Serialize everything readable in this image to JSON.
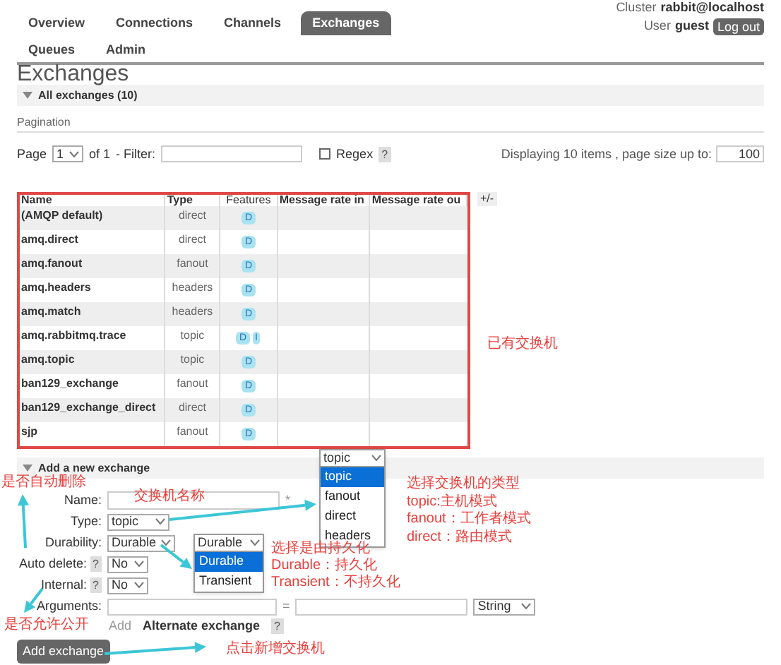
{
  "header": {
    "cluster_label": "Cluster",
    "cluster": "rabbit@localhost",
    "user_label": "User",
    "user": "guest",
    "logout": "Log out"
  },
  "tabs": [
    {
      "label": "Overview",
      "selected": false
    },
    {
      "label": "Connections",
      "selected": false
    },
    {
      "label": "Channels",
      "selected": false
    },
    {
      "label": "Exchanges",
      "selected": true
    },
    {
      "label": "Queues",
      "selected": false
    },
    {
      "label": "Admin",
      "selected": false
    }
  ],
  "page_title": "Exchanges",
  "all_section": {
    "title": "All exchanges (10)",
    "expanded": true
  },
  "pagination": {
    "label": "Pagination",
    "page_label": "Page",
    "page": "1",
    "of": "of 1",
    "filter_label": "- Filter:",
    "regex_label": "Regex",
    "regex_checked": false,
    "help": "?",
    "displaying": "Displaying 10 items , page size up to:",
    "page_size": "100"
  },
  "table": {
    "columns": [
      "Name",
      "Type",
      "Features",
      "Message rate in",
      "Message rate ou"
    ],
    "toggle": "+/-",
    "rows": [
      {
        "name": "(AMQP default)",
        "type": "direct",
        "features": [
          "D"
        ]
      },
      {
        "name": "amq.direct",
        "type": "direct",
        "features": [
          "D"
        ]
      },
      {
        "name": "amq.fanout",
        "type": "fanout",
        "features": [
          "D"
        ]
      },
      {
        "name": "amq.headers",
        "type": "headers",
        "features": [
          "D"
        ]
      },
      {
        "name": "amq.match",
        "type": "headers",
        "features": [
          "D"
        ]
      },
      {
        "name": "amq.rabbitmq.trace",
        "type": "topic",
        "features": [
          "D",
          "I"
        ]
      },
      {
        "name": "amq.topic",
        "type": "topic",
        "features": [
          "D"
        ]
      },
      {
        "name": "ban129_exchange",
        "type": "fanout",
        "features": [
          "D"
        ]
      },
      {
        "name": "ban129_exchange_direct",
        "type": "direct",
        "features": [
          "D"
        ]
      },
      {
        "name": "sjp",
        "type": "fanout",
        "features": [
          "D"
        ]
      }
    ]
  },
  "add_section": {
    "title": "Add a new exchange",
    "expanded": true,
    "fields": [
      {
        "kind": "text",
        "label": "Name:",
        "required": "*"
      },
      {
        "kind": "select",
        "label": "Type:",
        "value": "topic"
      },
      {
        "kind": "select",
        "label": "Durability:",
        "value": "Durable"
      },
      {
        "kind": "select_help",
        "label": "Auto delete:",
        "help": "?",
        "value": "No"
      },
      {
        "kind": "select_help",
        "label": "Internal:",
        "help": "?",
        "value": "No"
      },
      {
        "kind": "arguments",
        "label": "Arguments:",
        "separator": "=",
        "value_type": "String"
      },
      {
        "kind": "links",
        "add": "Add",
        "alternate": "Alternate exchange",
        "help": "?"
      }
    ],
    "button": "Add exchange"
  },
  "type_dropdown": {
    "value": "topic",
    "options": [
      {
        "label": "topic",
        "selected": true
      },
      {
        "label": "fanout",
        "selected": false
      },
      {
        "label": "direct",
        "selected": false
      },
      {
        "label": "headers",
        "selected": false
      }
    ]
  },
  "durability_dropdown": {
    "value": "Durable",
    "options": [
      {
        "label": "Durable",
        "selected": true
      },
      {
        "label": "Transient",
        "selected": false
      }
    ]
  },
  "annotations": {
    "existing": "已有交换机",
    "name_hint": "交换机名称",
    "auto_delete": "是否自动删除",
    "internal": "是否允许公开",
    "durability": [
      "选择是由持久化",
      "Durable：持久化",
      "Transient：不持久化"
    ],
    "type": [
      "选择交换机的类型",
      "topic:主机模式",
      "fanout：工作者模式",
      "direct：路由模式"
    ],
    "button": "点击新增交换机"
  }
}
